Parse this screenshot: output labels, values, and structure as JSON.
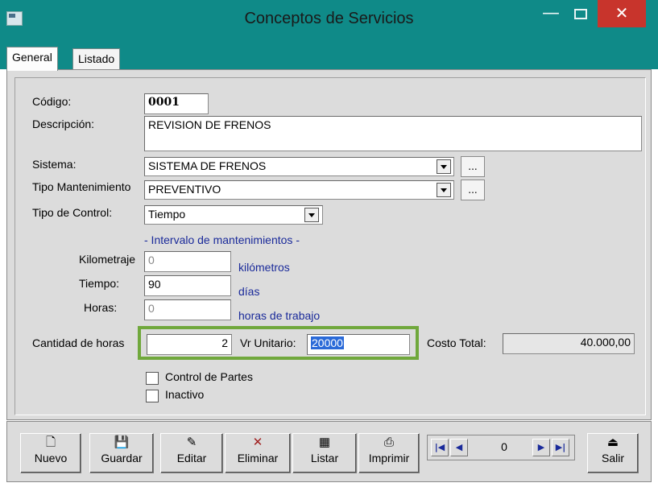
{
  "window": {
    "title": "Conceptos de Servicios",
    "min_icon": "minimize-icon",
    "max_icon": "maximize-icon",
    "close_icon": "close-icon",
    "close_glyph": "✕",
    "min_glyph": "—"
  },
  "tabs": [
    {
      "label": "General",
      "active": true
    },
    {
      "label": "Listado",
      "active": false
    }
  ],
  "form": {
    "codigo_label": "Código:",
    "codigo_value": "0001",
    "descripcion_label": "Descripción:",
    "descripcion_value": "REVISION DE FRENOS",
    "sistema_label": "Sistema:",
    "sistema_value": "SISTEMA DE FRENOS",
    "tipo_mant_label": "Tipo Mantenimiento",
    "tipo_mant_value": "PREVENTIVO",
    "tipo_control_label": "Tipo de Control:",
    "tipo_control_value": "Tiempo",
    "ellipsis": "...",
    "intervalo_heading": "- Intervalo de mantenimientos -",
    "km_label": "Kilometraje",
    "km_value": "0",
    "km_unit": "kilómetros",
    "tiempo_label": "Tiempo:",
    "tiempo_value": "90",
    "tiempo_unit": "días",
    "horas_label": "Horas:",
    "horas_value": "0",
    "horas_unit": "horas de trabajo",
    "cantidad_label": "Cantidad de horas",
    "cantidad_value": "2",
    "vr_unitario_label": "Vr Unitario:",
    "vr_unitario_value": "20000",
    "costo_total_label": "Costo Total:",
    "costo_total_value": "40.000,00",
    "control_partes_label": "Control de Partes",
    "inactivo_label": "Inactivo"
  },
  "toolbar": {
    "buttons": [
      {
        "label": "Nuevo",
        "icon": "new-document-icon",
        "glyph": "🗋"
      },
      {
        "label": "Guardar",
        "icon": "save-icon",
        "glyph": "💾"
      },
      {
        "label": "Editar",
        "icon": "edit-icon",
        "glyph": "✎"
      },
      {
        "label": "Eliminar",
        "icon": "delete-icon",
        "glyph": "✕"
      },
      {
        "label": "Listar",
        "icon": "list-icon",
        "glyph": "▦"
      },
      {
        "label": "Imprimir",
        "icon": "print-icon",
        "glyph": "⎙"
      },
      {
        "label": "Salir",
        "icon": "exit-icon",
        "glyph": "⏏"
      }
    ],
    "nav_value": "0",
    "nav_first": "|◀",
    "nav_prev": "◀",
    "nav_next": "▶",
    "nav_last": "▶|"
  },
  "colors": {
    "titlebar": "#0f8a88",
    "close_button": "#c8342c",
    "highlight_border": "#70a83c",
    "selection": "#2a6ad8"
  }
}
